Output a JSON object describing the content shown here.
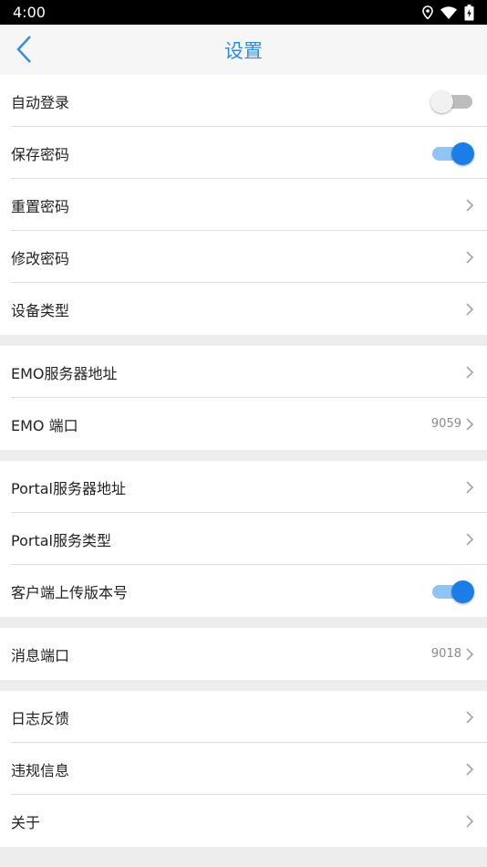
{
  "status_bar": {
    "time": "4:00",
    "icons": [
      "location-icon",
      "wifi-icon",
      "battery-icon"
    ]
  },
  "header": {
    "title": "设置",
    "back_icon": "chevron-left-icon"
  },
  "colors": {
    "accent": "#2b8ee6",
    "toggle_on": "#1a7ee8",
    "background": "#ededed"
  },
  "groups": [
    {
      "items": [
        {
          "label": "自动登录",
          "type": "toggle",
          "on": false
        },
        {
          "label": "保存密码",
          "type": "toggle",
          "on": true
        },
        {
          "label": "重置密码",
          "type": "link"
        },
        {
          "label": "修改密码",
          "type": "link"
        },
        {
          "label": "设备类型",
          "type": "link"
        }
      ]
    },
    {
      "items": [
        {
          "label": "EMO服务器地址",
          "type": "link"
        },
        {
          "label": "EMO 端口",
          "type": "link",
          "value": "9059"
        }
      ]
    },
    {
      "items": [
        {
          "label": "Portal服务器地址",
          "type": "link"
        },
        {
          "label": "Portal服务类型",
          "type": "link"
        },
        {
          "label": "客户端上传版本号",
          "type": "toggle",
          "on": true
        }
      ]
    },
    {
      "items": [
        {
          "label": "消息端口",
          "type": "link",
          "value": "9018"
        }
      ]
    },
    {
      "items": [
        {
          "label": "日志反馈",
          "type": "link"
        },
        {
          "label": "违规信息",
          "type": "link"
        },
        {
          "label": "关于",
          "type": "link"
        }
      ]
    }
  ]
}
